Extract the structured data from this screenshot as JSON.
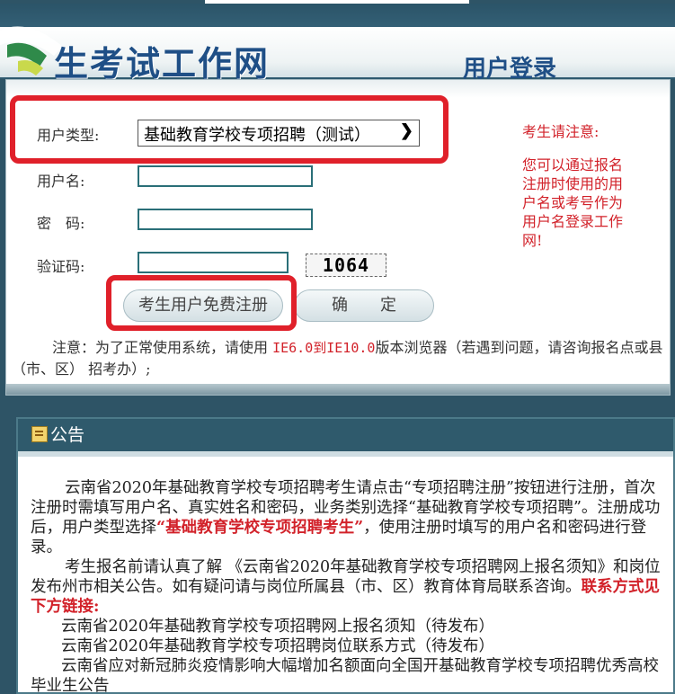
{
  "banner": {
    "title": "生考试工作网",
    "subtitle": "用户登录"
  },
  "login": {
    "user_type_label": "用户类型:",
    "user_type_value": "基础教育学校专项招聘（测试）",
    "username_label": "用户名:",
    "password_label": "密　码:",
    "captcha_label": "验证码:",
    "captcha_value": "1064",
    "register_button": "考生用户免费注册",
    "confirm_button": "确　　定",
    "notice_title": "考生请注意:",
    "notice_lines": [
      "您可以通过报名",
      "注册时使用的用",
      "户名或考号作为",
      "用户名登录工作",
      "网!"
    ],
    "browser_note_prefix": "注意：为了正常使用系统，请使用 ",
    "browser_note_highlight": "IE6.0到IE10.0",
    "browser_note_suffix": "版本浏览器（若遇到问题，请咨询报名点或县（市、区） 招考办）;"
  },
  "announcement": {
    "header": "公告",
    "p1_a": "云南省2020年基础教育学校专项招聘考生请点击“专项招聘注册”按钮进行注册，首次注册时需填写用户名、真实姓名和密码，业务类别选择“基础教育学校专项招聘”。注册成功后，用户类型选择",
    "p1_red": "“基础教育学校专项招聘考生”",
    "p1_b": "，使用注册时填写的用户名和密码进行登录。",
    "p2_a": "考生报名前请认真了解 《云南省2020年基础教育学校专项招聘网上报名须知》和岗位发布州市相关公告。如有疑问请与岗位所属县（市、区）教育体育局联系咨询。",
    "p2_red": "联系方式见下方链接:",
    "links": [
      "云南省2020年基础教育学校专项招聘网上报名须知（待发布）",
      "云南省2020年基础教育学校专项招聘岗位联系方式（待发布）",
      "云南省应对新冠肺炎疫情影响大幅增加名额面向全国开基础教育学校专项招聘优秀高校毕业生公告"
    ]
  },
  "colors": {
    "highlight_red": "#e0202a",
    "header_teal": "#2f5a6c"
  }
}
